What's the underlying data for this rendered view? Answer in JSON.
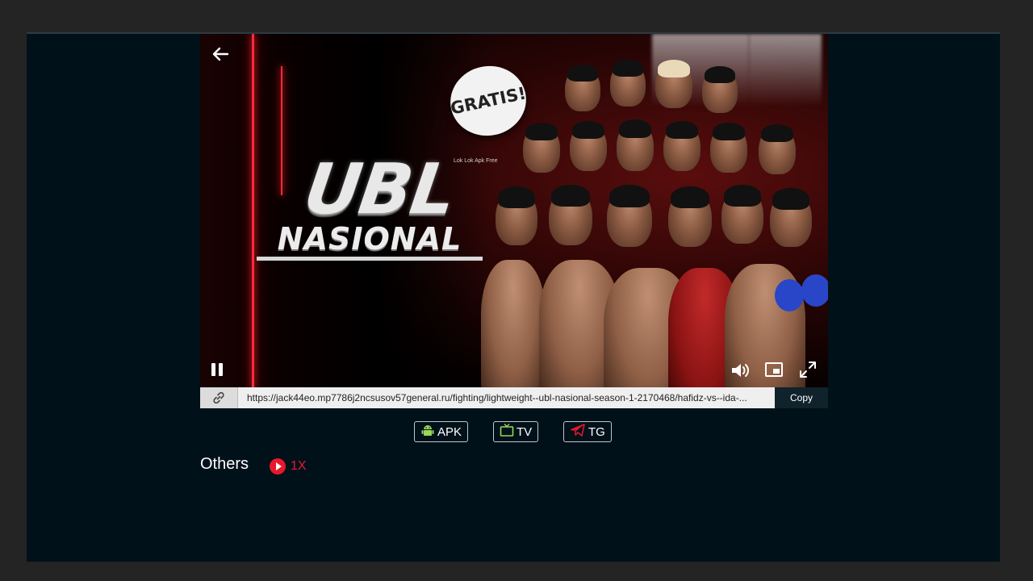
{
  "poster": {
    "badge": "GRATIS!",
    "title_line1": "UBL",
    "title_line2": "NASIONAL",
    "watermark": "Lok Lok Apk Free"
  },
  "share": {
    "url": "https://jack44eo.mp7786j2ncsusov57general.ru/fighting/lightweight--ubl-nasional-season-1-2170468/hafidz-vs--ida-...",
    "copy_label": "Copy"
  },
  "apps": [
    {
      "label": "APK",
      "icon": "android-icon"
    },
    {
      "label": "TV",
      "icon": "tv-icon"
    },
    {
      "label": "TG",
      "icon": "telegram-icon"
    }
  ],
  "others": {
    "label": "Others",
    "speed_label": "1X"
  },
  "colors": {
    "accent": "#e8192c",
    "background": "#00111a",
    "frame": "#242424"
  }
}
